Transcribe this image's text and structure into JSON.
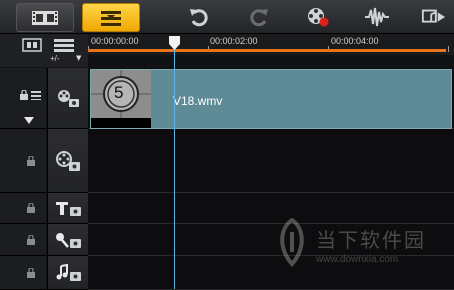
{
  "toolbar": {
    "buttons": [
      "storyboard-view",
      "timeline-view",
      "undo",
      "redo",
      "record-capture",
      "audio-mixer",
      "auto-music"
    ]
  },
  "ruler": {
    "times": [
      "00:00:00:00",
      "00:00:02:00",
      "00:00:04:00"
    ]
  },
  "track_header": {
    "add_remove": "+/-"
  },
  "clip": {
    "filename": "V18.wmv",
    "thumb_number": "5"
  },
  "watermark": {
    "cn": "当下软件园",
    "url": "www.downxia.com"
  },
  "colors": {
    "accent": "#f0a800",
    "clip": "#5f8b96",
    "playhead": "#5ab4e8",
    "timebar": "#e8741c"
  }
}
